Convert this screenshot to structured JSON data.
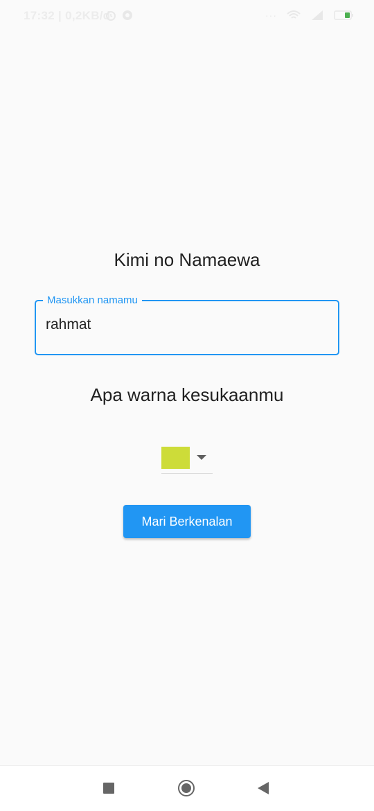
{
  "status_bar": {
    "time": "17:32 | 0,2KB/d",
    "icons": [
      "alarm-icon",
      "sync-icon",
      "more-icon",
      "wifi-icon",
      "signal-icon",
      "battery-icon"
    ],
    "battery_color": "#4caf50"
  },
  "form": {
    "title": "Kimi no Namaewa",
    "name_field": {
      "label": "Masukkan namamu",
      "value": "rahmat"
    },
    "color_prompt": "Apa warna kesukaanmu",
    "color_dropdown": {
      "selected_color": "#cddc39"
    },
    "submit_label": "Mari Berkenalan"
  },
  "colors": {
    "accent": "#2196f3",
    "background": "#fafafa"
  },
  "nav_bar": {
    "icons": [
      "recents-icon",
      "home-icon",
      "back-icon"
    ]
  }
}
